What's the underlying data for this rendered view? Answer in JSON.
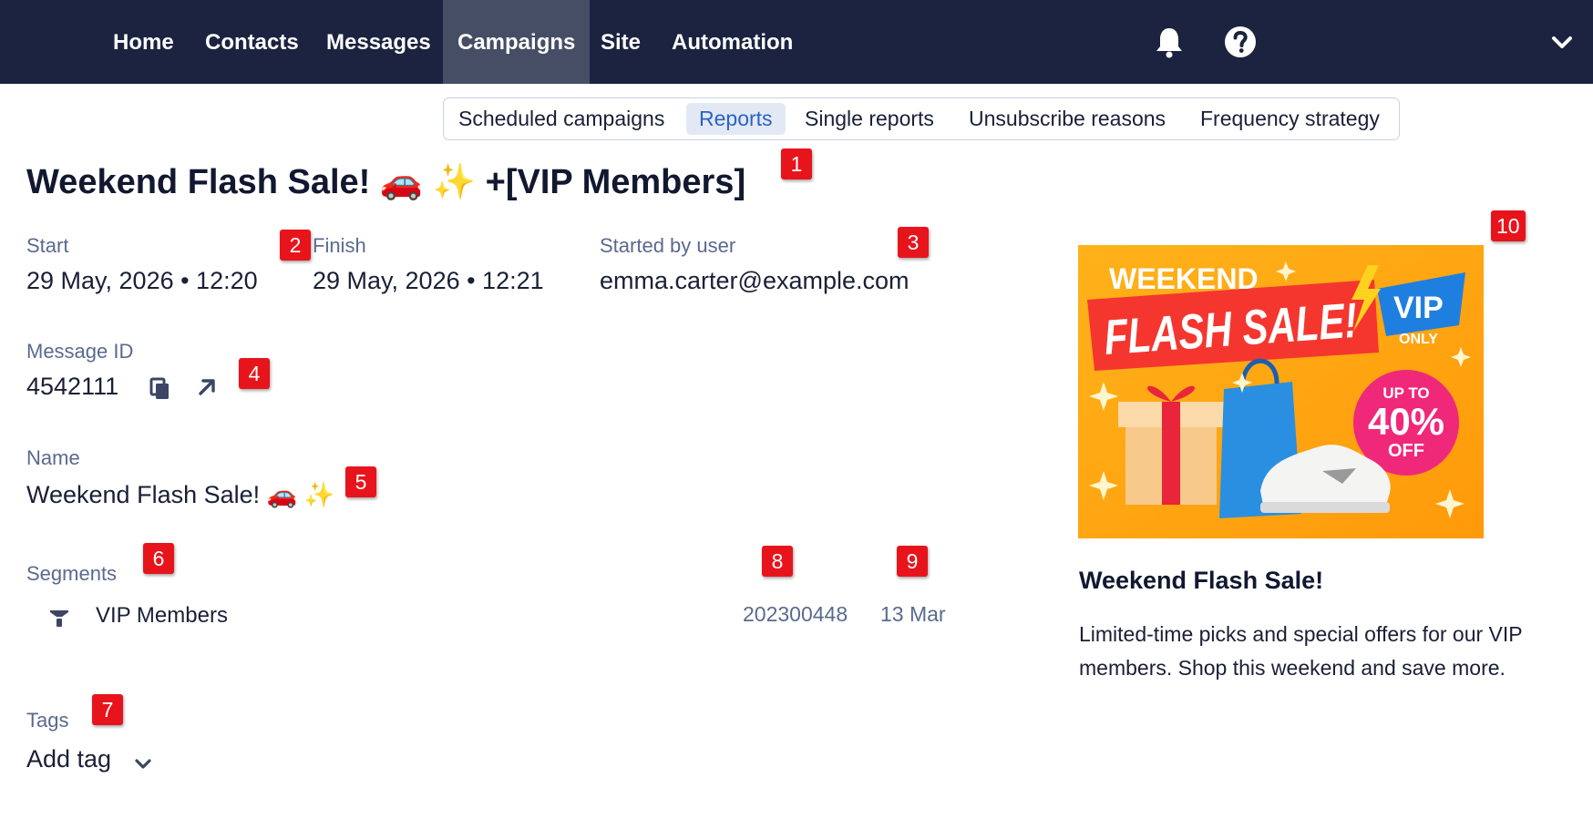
{
  "nav": {
    "items": [
      "Home",
      "Contacts",
      "Messages",
      "Campaigns",
      "Site",
      "Automation"
    ],
    "active": "Campaigns",
    "icons": [
      "bell-icon",
      "help-icon",
      "chevron-down-icon"
    ]
  },
  "subtabs": {
    "items": [
      "Scheduled campaigns",
      "Reports",
      "Single reports",
      "Unsubscribe reasons",
      "Frequency strategy"
    ],
    "active": "Reports"
  },
  "title": "Weekend Flash Sale! 🚗 ✨ +[VIP Members]",
  "start": {
    "label": "Start",
    "value": "29 May, 2026 • 12:20"
  },
  "finish": {
    "label": "Finish",
    "value": "29 May, 2026 • 12:21"
  },
  "started_by": {
    "label": "Started by user",
    "value": "emma.carter@example.com"
  },
  "message_id": {
    "label": "Message ID",
    "value": "4542111",
    "icons": [
      "copy-icon",
      "external-link-icon"
    ]
  },
  "name": {
    "label": "Name",
    "value": "Weekend Flash Sale! 🚗 ✨"
  },
  "segments": {
    "label": "Segments",
    "items": [
      {
        "name": "VIP Members",
        "id": "202300448",
        "date": "13 Mar",
        "icon": "filter-icon"
      }
    ]
  },
  "tags": {
    "label": "Tags",
    "add_label": "Add tag"
  },
  "promo": {
    "image": {
      "headline_1": "WEEKEND",
      "headline_2": "FLASH SALE!",
      "vip": "VIP",
      "only": "ONLY",
      "up_to": "UP TO",
      "percent": "40%",
      "off": "OFF"
    },
    "title": "Weekend Flash Sale!",
    "description": "Limited-time picks and special offers for our VIP members. Shop this weekend and save more."
  },
  "badges": [
    "1",
    "2",
    "3",
    "4",
    "5",
    "6",
    "7",
    "8",
    "9",
    "10"
  ],
  "colors": {
    "nav_bg": "#1b2340",
    "nav_active": "#464e66",
    "accent": "#2a62c4",
    "badge": "#e8141c",
    "label": "#5a6a8e"
  }
}
